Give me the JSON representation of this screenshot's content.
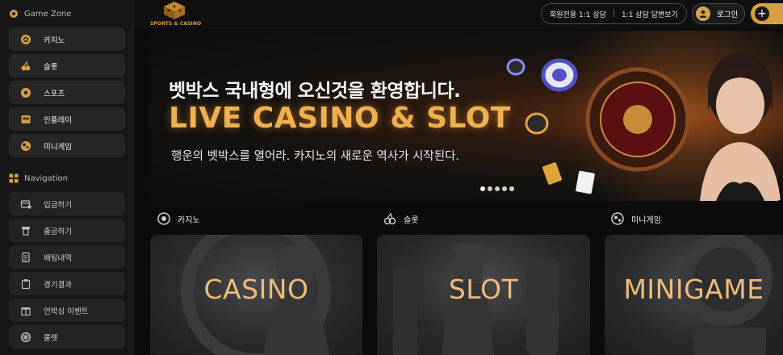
{
  "sidebar": {
    "game_zone_title": "Game Zone",
    "game_items": [
      {
        "label": "카지노",
        "icon": "poker-chip-icon"
      },
      {
        "label": "슬롯",
        "icon": "cherries-icon"
      },
      {
        "label": "스포츠",
        "icon": "soccer-ball-icon"
      },
      {
        "label": "인플레이",
        "icon": "scoreboard-icon"
      },
      {
        "label": "미니게임",
        "icon": "minigame-ball-icon"
      }
    ],
    "navigation_title": "Navigation",
    "nav_items": [
      {
        "label": "입금하기",
        "icon": "deposit-icon"
      },
      {
        "label": "출금하기",
        "icon": "withdraw-icon"
      },
      {
        "label": "배팅내역",
        "icon": "betting-history-icon"
      },
      {
        "label": "경기결과",
        "icon": "match-results-icon"
      },
      {
        "label": "언박싱 이벤트",
        "icon": "gift-box-icon"
      },
      {
        "label": "룰렛",
        "icon": "roulette-icon"
      }
    ]
  },
  "header": {
    "logo_text": "SPORTS & CASINO",
    "support_member": "회원전용 1:1 상담",
    "support_reply": "1:1 상담 답변보기",
    "login_label": "로그인",
    "join_icon": "plus-icon"
  },
  "banner": {
    "headline": "벳박스 국내형에 오신것을 환영합니다.",
    "title": "LIVE CASINO & SLOT",
    "subtitle": "행운의 벳박스를 열어라. 카지노의 새로운 역사가 시작된다.",
    "slide_count": 5,
    "active_slide": 1
  },
  "categories": [
    {
      "title": "카지노",
      "icon": "poker-chip-icon",
      "card_label": "CASINO"
    },
    {
      "title": "슬롯",
      "icon": "cherries-icon",
      "card_label": "SLOT"
    },
    {
      "title": "미니게임",
      "icon": "minigame-ball-icon",
      "card_label": "MINIGAME"
    }
  ],
  "colors": {
    "accent_gold": "#d89f41",
    "card_label": "#eebc78",
    "banner_title": "#eeb04f"
  }
}
